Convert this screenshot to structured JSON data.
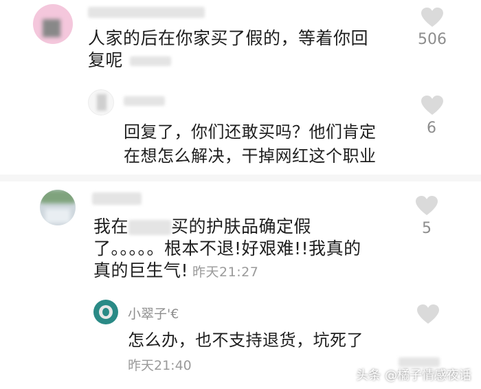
{
  "comments": [
    {
      "text_line1": "人家的后在你家买了假的，等着你回",
      "text_line2": "复呢",
      "timestamp": "",
      "likes": "506",
      "replies": [
        {
          "username": "",
          "text_line1": "回复了，你们还敢买吗？他们肯定",
          "text_line2": "在想怎么解决，干掉网红这个职业",
          "likes": "6"
        }
      ]
    },
    {
      "text_line1": "我在",
      "text_line1b": "买的护肤品确定假",
      "text_line2": "了。。。。。根本不退!好艰难!!我真的",
      "text_line3": "真的巨生气!",
      "timestamp": "昨天21:27",
      "likes": "5",
      "replies": [
        {
          "username": "小翠子'€",
          "text_line1": "怎么办，也不支持退货，坑死了",
          "timestamp": "昨天21:40",
          "likes": ""
        }
      ]
    }
  ],
  "watermark": "头条 @橘子情感夜话",
  "colors": {
    "heart": "#d9d9d9",
    "count": "#8d8d8d",
    "timestamp": "#9a9a9a"
  },
  "icons": [
    "heart-icon"
  ]
}
